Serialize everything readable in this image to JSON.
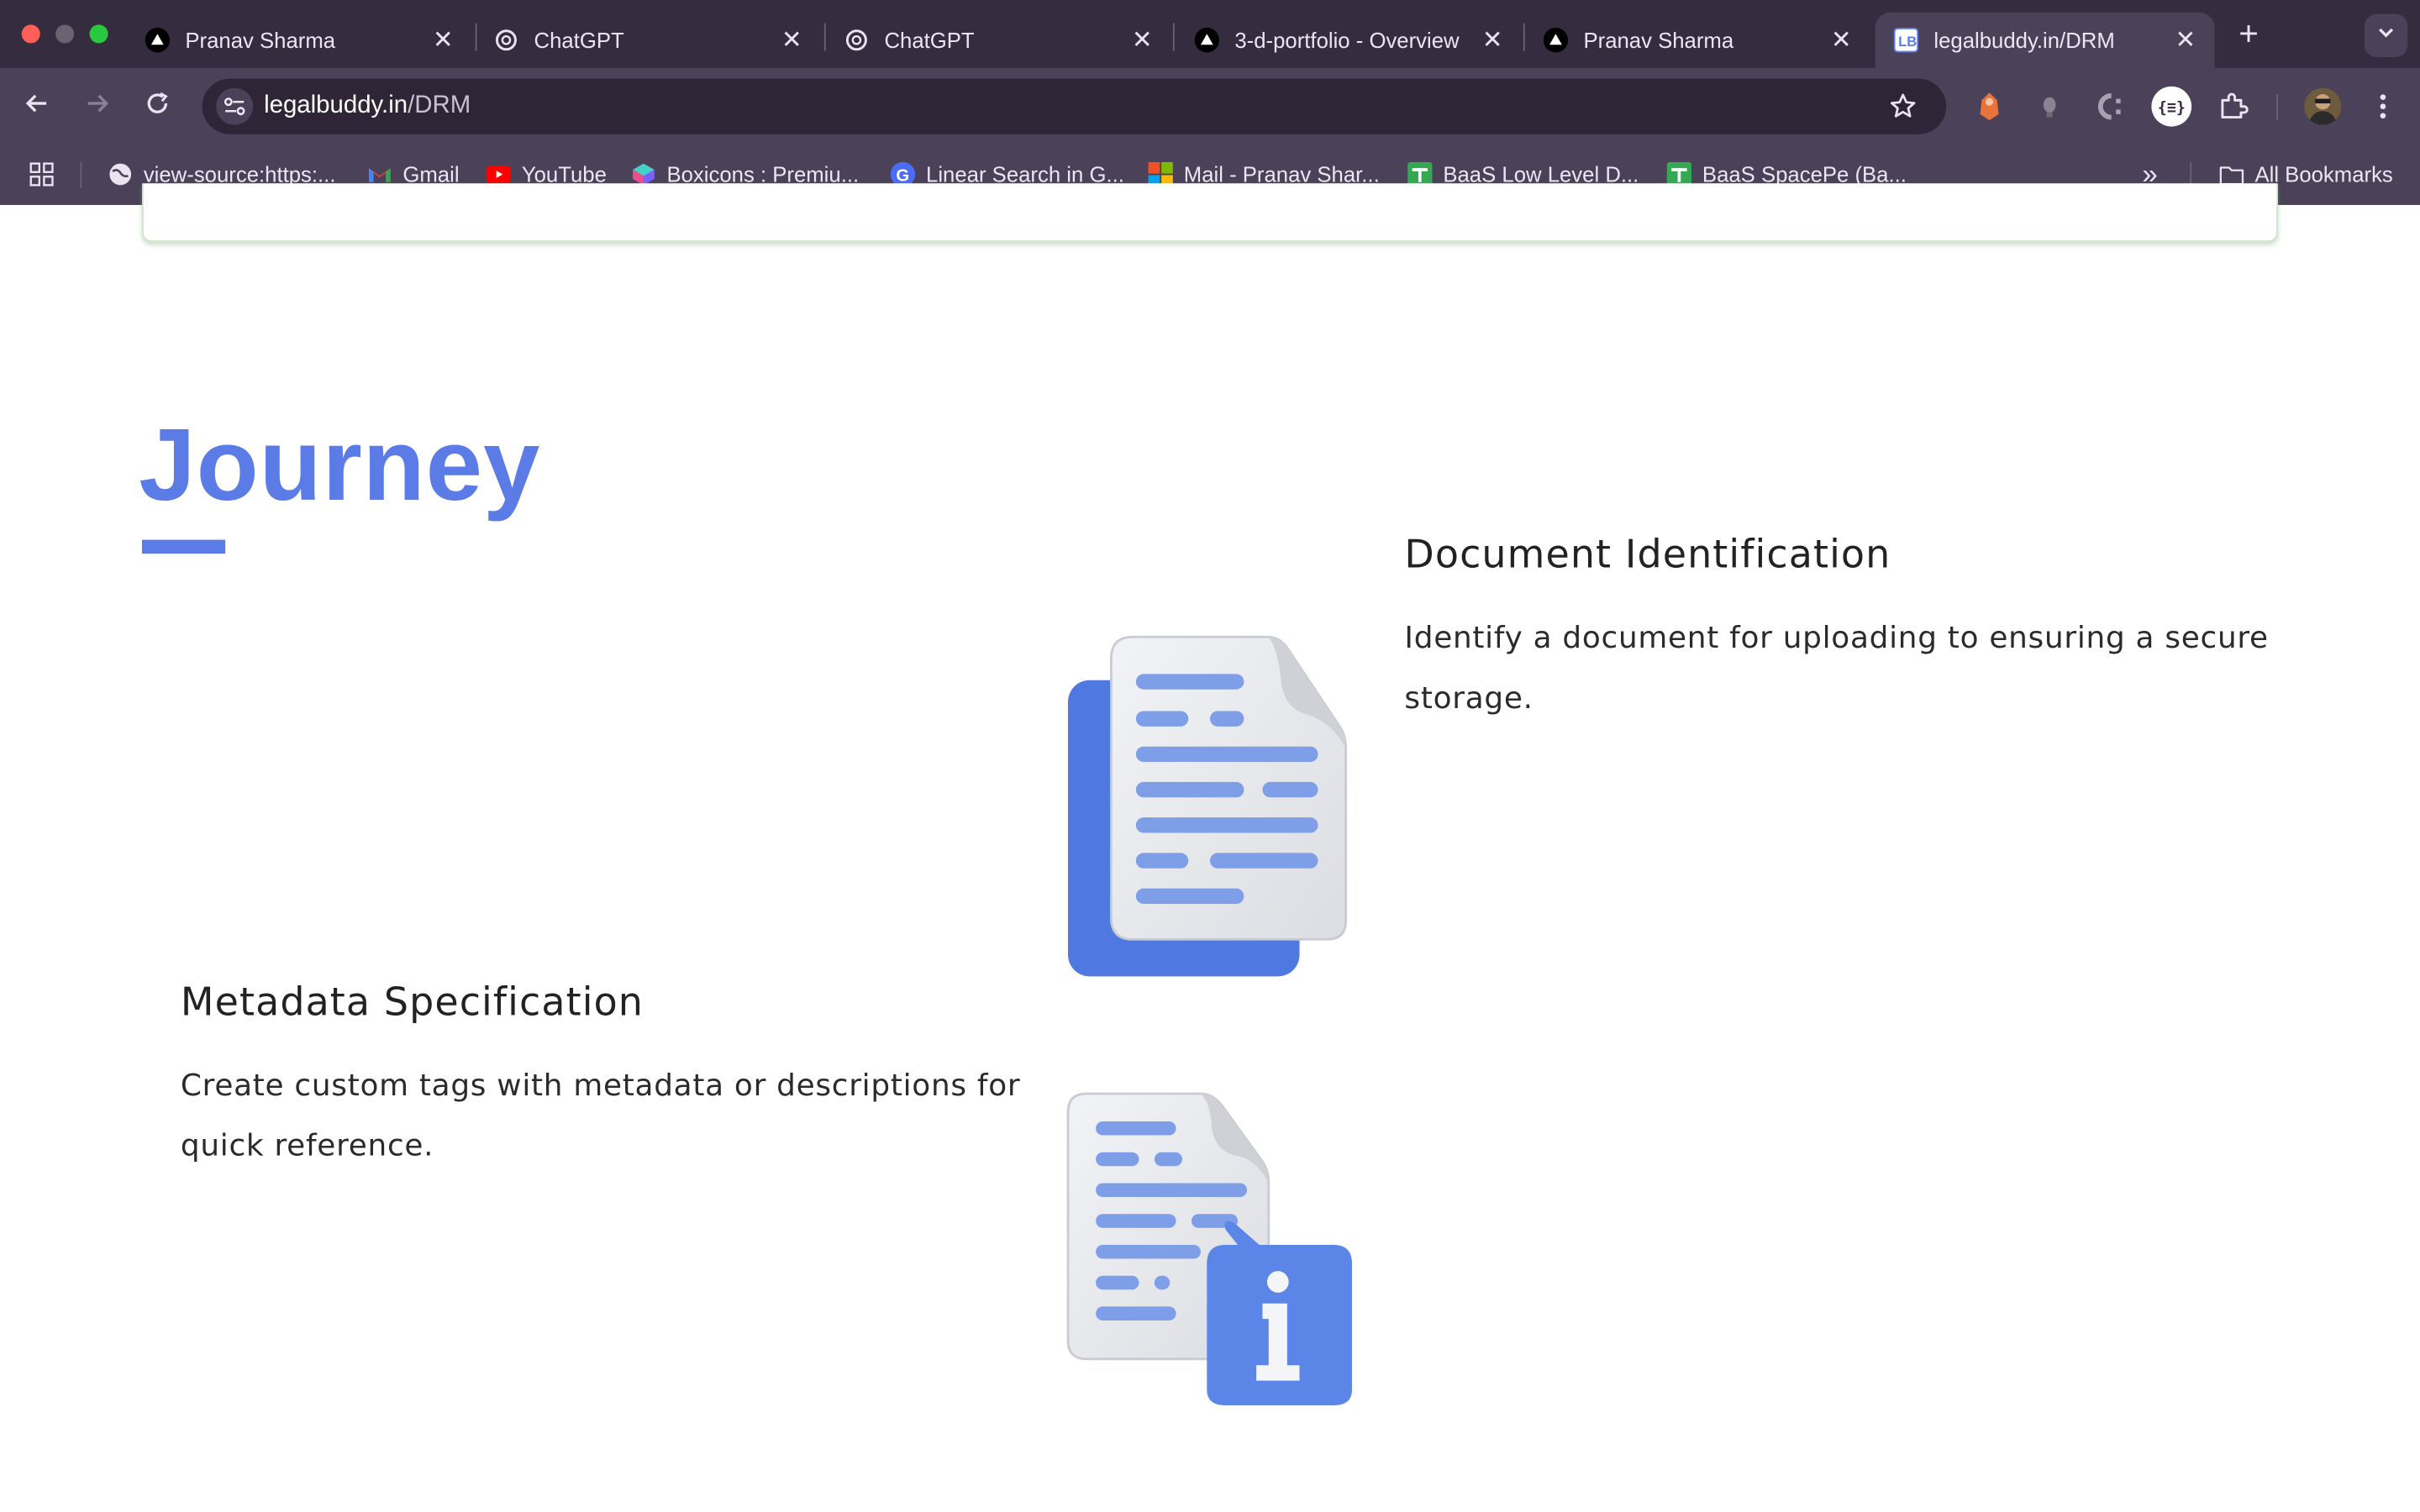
{
  "browser": {
    "tabs": [
      {
        "title": "Pranav Sharma",
        "icon": "vercel-icon",
        "active": false
      },
      {
        "title": "ChatGPT",
        "icon": "openai-icon",
        "active": false
      },
      {
        "title": "ChatGPT",
        "icon": "openai-icon",
        "active": false
      },
      {
        "title": "3-d-portfolio - Overview",
        "icon": "vercel-icon",
        "active": false
      },
      {
        "title": "Pranav Sharma",
        "icon": "vercel-icon",
        "active": false
      },
      {
        "title": "legalbuddy.in/DRM",
        "icon": "legalbuddy-icon",
        "active": true
      }
    ],
    "close_glyph": "✕",
    "new_tab_glyph": "+",
    "address": {
      "host": "legalbuddy.in",
      "path": "/DRM"
    },
    "bookmarks": [
      {
        "label": "view-source:https:...",
        "icon": "globe-icon"
      },
      {
        "label": "Gmail",
        "icon": "gmail-icon"
      },
      {
        "label": "YouTube",
        "icon": "youtube-icon"
      },
      {
        "label": "Boxicons : Premiu...",
        "icon": "boxicons-icon"
      },
      {
        "label": "Linear Search in G...",
        "icon": "google-icon"
      },
      {
        "label": "Mail - Pranav Shar...",
        "icon": "microsoft-icon"
      },
      {
        "label": "BaaS Low Level D...",
        "icon": "sheets-icon"
      },
      {
        "label": "BaaS SpacePe (Ba...",
        "icon": "sheets-icon"
      }
    ],
    "more_bookmarks_glyph": "»",
    "all_bookmarks": "All Bookmarks",
    "colors": {
      "frame": "#352c40",
      "toolbar": "#4b4158",
      "omnibox": "#2e2636"
    }
  },
  "page": {
    "section_title": "Journey",
    "accent_color": "#5b7be6",
    "steps": [
      {
        "title": "Document Identification",
        "description": "Identify a document for uploading to ensuring a secure storage.",
        "icon": "document-stack-icon"
      },
      {
        "title": "Metadata Specification",
        "description": "Create custom tags with metadata or descriptions for quick reference.",
        "icon": "document-info-icon"
      }
    ]
  }
}
